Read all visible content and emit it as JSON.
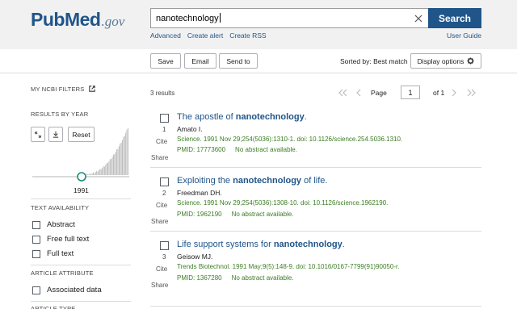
{
  "logo": {
    "pub": "Pub",
    "med": "Med",
    "gov": ".gov"
  },
  "search": {
    "value": "nanotechnology",
    "button_label": "Search"
  },
  "sublinks": [
    "Advanced",
    "Create alert",
    "Create RSS"
  ],
  "user_guide": "User Guide",
  "toolbar": {
    "save_label": "Save",
    "email_label": "Email",
    "send_to_label": "Send to",
    "sorted_by": "Sorted by: Best match",
    "display_options": "Display options"
  },
  "sidebar": {
    "my_filters": "MY NCBI FILTERS",
    "results_by_year": "RESULTS BY YEAR",
    "reset_label": "Reset",
    "year_label": "1991",
    "text_availability": "TEXT AVAILABILITY",
    "text_options": [
      "Abstract",
      "Free full text",
      "Full text"
    ],
    "article_attribute": "ARTICLE ATTRIBUTE",
    "attribute_options": [
      "Associated data"
    ],
    "article_type": "ARTICLE TYPE"
  },
  "results": {
    "count": "3 results",
    "page_label": "Page",
    "page_value": "1",
    "of_label": "of 1",
    "cite_label": "Cite",
    "share_label": "Share",
    "items": [
      {
        "num": "1",
        "title_pre": "The apostle of ",
        "title_hl": "nanotechnology",
        "title_post": ".",
        "authors": "Amato I.",
        "citation": "Science. 1991 Nov 29;254(5036):1310-1. doi: 10.1126/science.254.5036.1310.",
        "pmid": "PMID: 17773600",
        "abstract_note": "No abstract available."
      },
      {
        "num": "2",
        "title_pre": "Exploiting the ",
        "title_hl": "nanotechnology",
        "title_post": " of life.",
        "authors": "Freedman DH.",
        "citation": "Science. 1991 Nov 29;254(5036):1308-10. doi: 10.1126/science.1962190.",
        "pmid": "PMID: 1962190",
        "abstract_note": "No abstract available."
      },
      {
        "num": "3",
        "title_pre": "Life support systems for ",
        "title_hl": "nanotechnology",
        "title_post": ".",
        "authors": "Geisow MJ.",
        "citation": "Trends Biotechnol. 1991 May;9(5):148-9. doi: 10.1016/0167-7799(91)90050-r.",
        "pmid": "PMID: 1367280",
        "abstract_note": "No abstract available."
      }
    ]
  },
  "colors": {
    "brand": "#20558a",
    "citation": "#3a7d23",
    "chart_bar": "#b8b8b8",
    "slider": "#1b8a7a"
  },
  "icons": [
    "external-link-icon",
    "expand-icon",
    "download-icon",
    "gear-icon",
    "close-icon",
    "first-page-icon",
    "prev-page-icon",
    "next-page-icon",
    "last-page-icon"
  ]
}
